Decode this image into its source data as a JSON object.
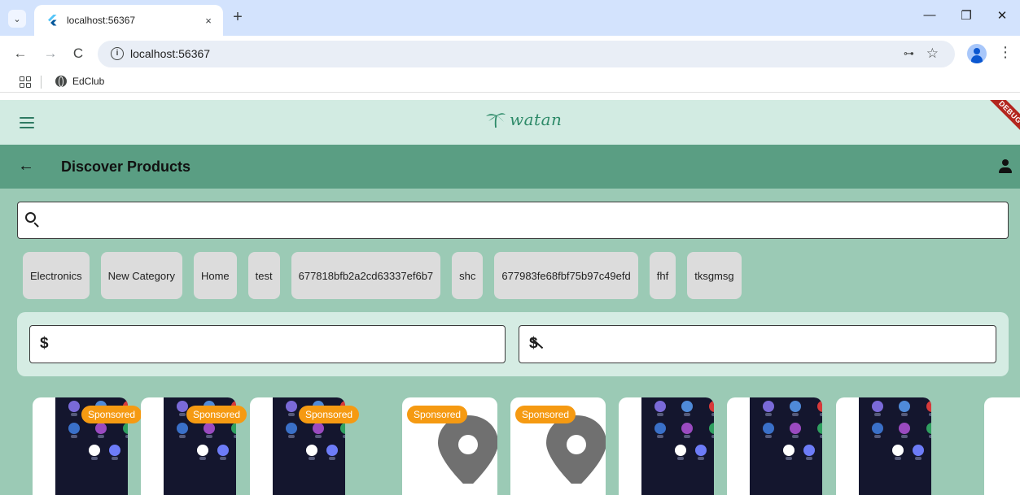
{
  "browser": {
    "tab_title": "localhost:56367",
    "tab_close": "×",
    "new_tab": "+",
    "url": "localhost:56367",
    "bookmark": "EdClub",
    "back": "←",
    "forward": "→",
    "reload": "C",
    "info": "i",
    "key": "⊶",
    "star": "☆",
    "menu": "⋮",
    "tab_search": "⌄",
    "minimize": "—",
    "restore": "❐",
    "close_window": "✕"
  },
  "app": {
    "logo_text": "watan",
    "debug_banner": "DEBUG",
    "title": "Discover Products",
    "back_symbol": "←",
    "search": {
      "value": "",
      "placeholder": ""
    },
    "categories": [
      "Electronics",
      "New Category",
      "Home",
      "test",
      "677818bfb2a2cd63337ef6b7",
      "shc",
      "677983fe68fbf75b97c49efd",
      "fhf",
      "tksgmsg"
    ],
    "price": {
      "min_symbol": "$",
      "max_symbol": "$",
      "min_value": "",
      "max_value": ""
    },
    "products": [
      {
        "image": "app-grid-screenshot",
        "sponsored": "Sponsored"
      },
      {
        "image": "app-grid-screenshot",
        "sponsored": "Sponsored"
      },
      {
        "image": "app-grid-screenshot",
        "sponsored": "Sponsored"
      },
      {
        "image": "location-pin-icon",
        "sponsored": "Sponsored"
      },
      {
        "image": "location-pin-icon",
        "sponsored": "Sponsored"
      },
      {
        "image": "app-grid-screenshot",
        "sponsored": ""
      },
      {
        "image": "app-grid-screenshot",
        "sponsored": ""
      },
      {
        "image": "app-grid-screenshot",
        "sponsored": ""
      },
      {
        "image": "partial-card",
        "sponsored": ""
      }
    ]
  },
  "colors": {
    "page_bg": "#9bcab5",
    "header_bg": "#d2ebe2",
    "appbar_bg": "#5a9e83",
    "chip_bg": "#dcdcdc",
    "badge_bg": "#f59a12",
    "debug_bg": "#b3261e",
    "browser_tabstrip": "#d3e3fd"
  }
}
